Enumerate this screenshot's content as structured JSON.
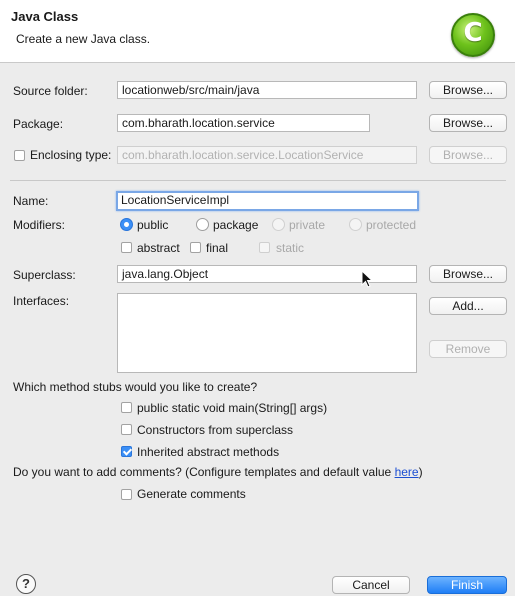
{
  "header": {
    "title": "Java Class",
    "subtitle": "Create a new Java class.",
    "logo_letter": "C",
    "logo_icon": "new-class-wizard-icon"
  },
  "source_folder": {
    "label": "Source folder:",
    "value": "locationweb/src/main/java",
    "browse": "Browse..."
  },
  "package": {
    "label": "Package:",
    "value": "com.bharath.location.service",
    "browse": "Browse..."
  },
  "enclosing_type": {
    "label": "Enclosing type:",
    "value": "com.bharath.location.service.LocationService",
    "browse": "Browse..."
  },
  "name": {
    "label": "Name:",
    "value": "LocationServiceImpl"
  },
  "modifiers": {
    "label": "Modifiers:",
    "public": "public",
    "package": "package",
    "private": "private",
    "protected": "protected",
    "abstract": "abstract",
    "final": "final",
    "static": "static"
  },
  "superclass": {
    "label": "Superclass:",
    "value": "java.lang.Object",
    "browse": "Browse..."
  },
  "interfaces": {
    "label": "Interfaces:",
    "add": "Add...",
    "remove": "Remove"
  },
  "stubs": {
    "question": "Which method stubs would you like to create?",
    "main": "public static void main(String[] args)",
    "constructors": "Constructors from superclass",
    "inherited": "Inherited abstract methods"
  },
  "comments": {
    "question_prefix": "Do you want to add comments? (Configure templates and default value ",
    "link": "here",
    "question_suffix": ")",
    "generate": "Generate comments"
  },
  "footer": {
    "help": "?",
    "cancel": "Cancel",
    "finish": "Finish"
  },
  "colors": {
    "accent": "#3b8ff6",
    "finish_button": "#1f7ef6",
    "link": "#1c4fd2"
  }
}
